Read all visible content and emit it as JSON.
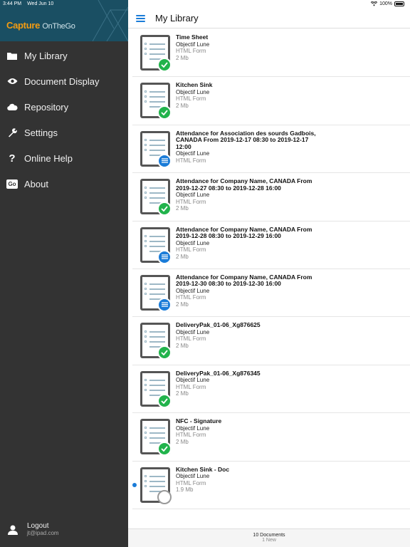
{
  "status": {
    "time": "3:44 PM",
    "date": "Wed Jun 10",
    "battery": "100%"
  },
  "sidebar": {
    "brand": {
      "name": "Capture",
      "sub": "OnTheGo"
    },
    "items": [
      {
        "label": "My Library",
        "icon": "folder-icon"
      },
      {
        "label": "Document Display",
        "icon": "eye-icon"
      },
      {
        "label": "Repository",
        "icon": "cloud-icon"
      },
      {
        "label": "Settings",
        "icon": "wrench-icon"
      },
      {
        "label": "Online Help",
        "icon": "question-icon"
      },
      {
        "label": "About",
        "icon": "go-icon"
      }
    ],
    "logout": {
      "label": "Logout",
      "user": "jt@ipad.com"
    }
  },
  "header": {
    "title": "My Library"
  },
  "documents": [
    {
      "name": "Time Sheet",
      "company": "Objectif Lune",
      "type": "HTML Form",
      "size": "2 Mb",
      "status": "check"
    },
    {
      "name": "Kitchen Sink",
      "company": "Objectif Lune",
      "type": "HTML Form",
      "size": "2 Mb",
      "status": "check"
    },
    {
      "name": "Attendance for Association des sourds Gadbois, CANADA From 2019-12-17 08:30 to 2019-12-17 12:00",
      "company": "Objectif Lune",
      "type": "HTML Form",
      "size": "",
      "status": "list"
    },
    {
      "name": "Attendance for Company Name, CANADA From 2019-12-27 08:30 to 2019-12-28 16:00",
      "company": "Objectif Lune",
      "type": "HTML Form",
      "size": "2 Mb",
      "status": "check"
    },
    {
      "name": "Attendance for Company Name, CANADA From 2019-12-28 08:30 to 2019-12-29 16:00",
      "company": "Objectif Lune",
      "type": "HTML Form",
      "size": "2 Mb",
      "status": "list"
    },
    {
      "name": "Attendance for Company Name, CANADA From 2019-12-30 08:30 to 2019-12-30 16:00",
      "company": "Objectif Lune",
      "type": "HTML Form",
      "size": "2 Mb",
      "status": "list"
    },
    {
      "name": "DeliveryPak_01-06_Xg876625",
      "company": "Objectif Lune",
      "type": "HTML Form",
      "size": "2 Mb",
      "status": "check"
    },
    {
      "name": "DeliveryPak_01-06_Xg876345",
      "company": "Objectif Lune",
      "type": "HTML Form",
      "size": "2 Mb",
      "status": "check"
    },
    {
      "name": "NFC - Signature",
      "company": "Objectif Lune",
      "type": "HTML Form",
      "size": "2 Mb",
      "status": "check"
    },
    {
      "name": "Kitchen Sink - Doc",
      "company": "Objectif Lune",
      "type": "HTML Form",
      "size": "1.9 Mb",
      "status": "empty",
      "new": true
    }
  ],
  "footer": {
    "count": "10 Documents",
    "new": "1 New"
  },
  "colors": {
    "sidebar": "#333333",
    "brand_bg": "#1a4f63",
    "accent": "#1a7cd8",
    "check": "#22b34c",
    "brand_orange": "#f39c12"
  }
}
